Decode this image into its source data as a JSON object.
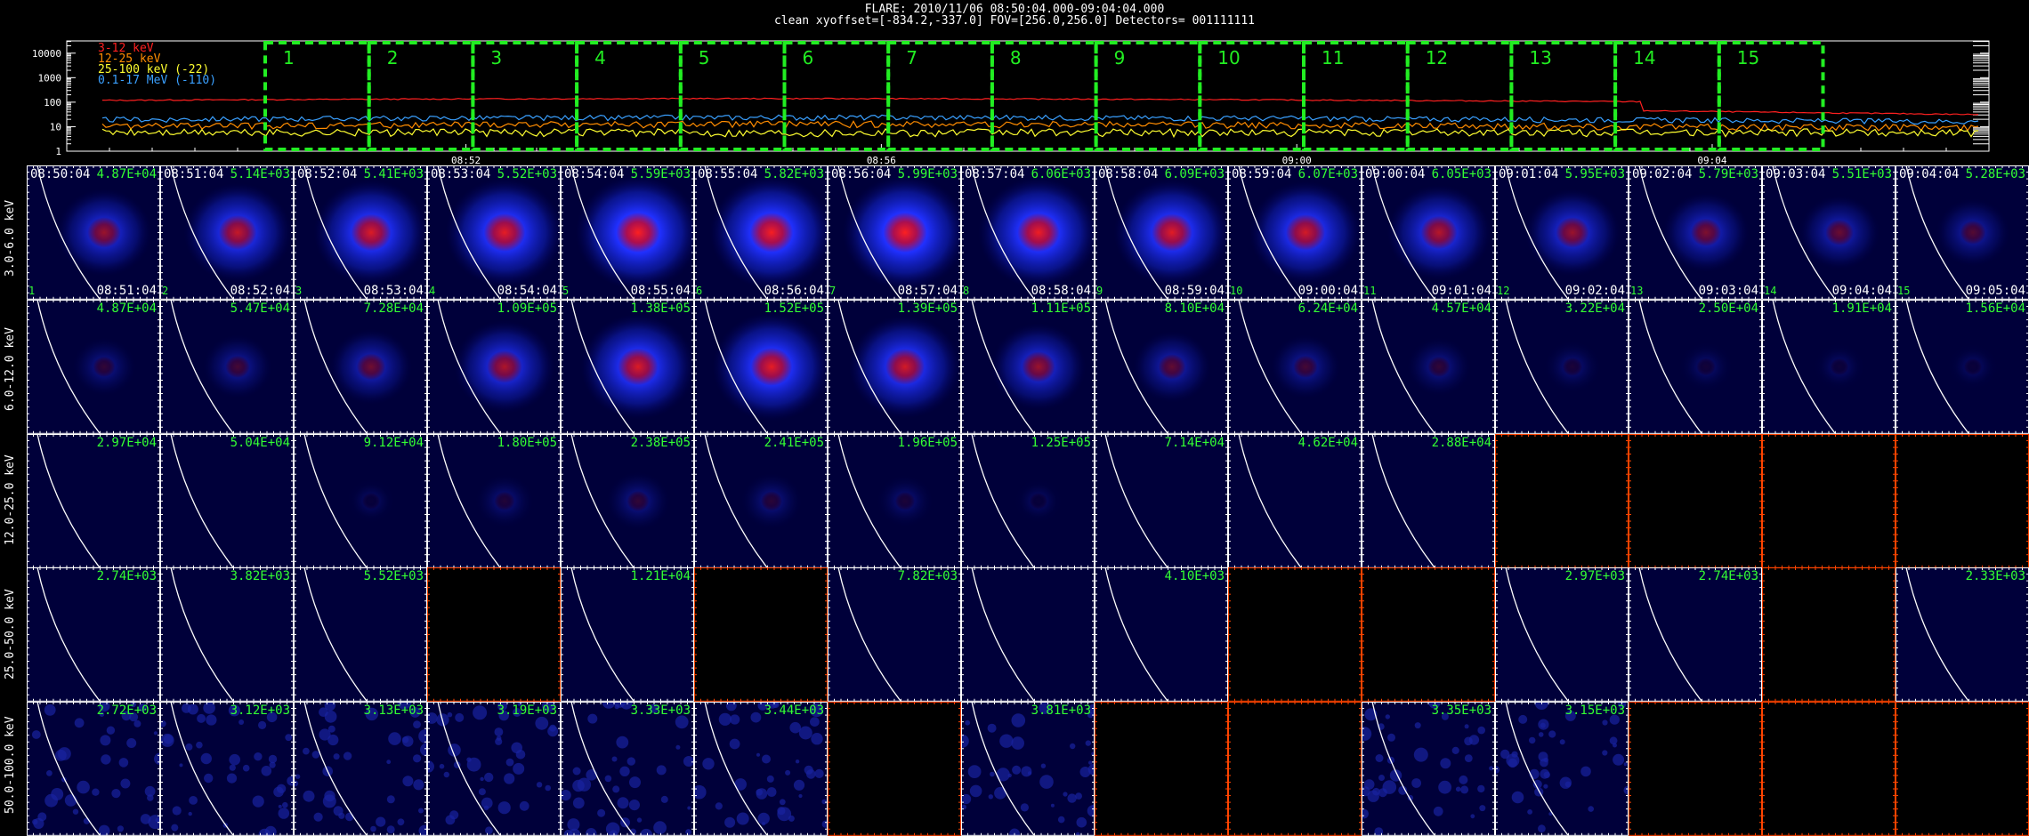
{
  "header": {
    "title": "FLARE: 2010/11/06 08:50:04.000-09:04:04.000",
    "subtitle": "clean    xyoffset=[-834.2,-337.0]   FOV=[256.0,256.0]   Detectors= 001111111"
  },
  "lightcurve": {
    "y_ticks": [
      "10000",
      "1000",
      "100",
      "10",
      "1"
    ],
    "x_ticks": [
      "08:52",
      "08:56",
      "09:00",
      "09:04"
    ],
    "legend": [
      {
        "label": "3-12 keV",
        "color": "#ff2020"
      },
      {
        "label": "12-25 keV",
        "color": "#ff8c00"
      },
      {
        "label": "25-100 keV (-22)",
        "color": "#ffff30"
      },
      {
        "label": "0.1-17 MeV (-110)",
        "color": "#3aa0ff"
      }
    ],
    "intervals": [
      "1",
      "2",
      "3",
      "4",
      "5",
      "6",
      "7",
      "8",
      "9",
      "10",
      "11",
      "12",
      "13",
      "14",
      "15"
    ],
    "interval_color": "#22ee22"
  },
  "grid": {
    "bands": [
      "3.0-6.0 keV",
      "6.0-12.0 keV",
      "12.0-25.0 keV",
      "25.0-50.0 keV",
      "50.0-100.0 keV"
    ],
    "start_times": [
      "08:50:04",
      "08:51:04",
      "08:52:04",
      "08:53:04",
      "08:54:04",
      "08:55:04",
      "08:56:04",
      "08:57:04",
      "08:58:04",
      "08:59:04",
      "09:00:04",
      "09:01:04",
      "09:02:04",
      "09:03:04",
      "09:04:04"
    ],
    "end_times": [
      "08:51:04",
      "08:52:04",
      "08:53:04",
      "08:54:04",
      "08:55:04",
      "08:56:04",
      "08:57:04",
      "08:58:04",
      "08:59:04",
      "09:00:04",
      "09:01:04",
      "09:02:04",
      "09:03:04",
      "09:04:04",
      "09:05:04"
    ],
    "indices": [
      "1",
      "2",
      "3",
      "4",
      "5",
      "6",
      "7",
      "8",
      "9",
      "10",
      "11",
      "12",
      "13",
      "14",
      "15"
    ],
    "peaks": [
      [
        "4.87E+04",
        "5.14E+03",
        "5.41E+03",
        "5.52E+03",
        "5.59E+03",
        "5.82E+03",
        "5.99E+03",
        "6.06E+03",
        "6.09E+03",
        "6.07E+03",
        "6.05E+03",
        "5.95E+03",
        "5.79E+03",
        "5.51E+03",
        "5.28E+03"
      ],
      [
        "4.87E+04",
        "5.47E+04",
        "7.28E+04",
        "1.09E+05",
        "1.38E+05",
        "1.52E+05",
        "1.39E+05",
        "1.11E+05",
        "8.10E+04",
        "6.24E+04",
        "4.57E+04",
        "3.22E+04",
        "2.50E+04",
        "1.91E+04",
        "1.56E+04"
      ],
      [
        "2.97E+04",
        "5.04E+04",
        "9.12E+04",
        "1.80E+05",
        "2.38E+05",
        "2.41E+05",
        "1.96E+05",
        "1.25E+05",
        "7.14E+04",
        "4.62E+04",
        "2.88E+04",
        "",
        "",
        "",
        ""
      ],
      [
        "2.74E+03",
        "3.82E+03",
        "5.52E+03",
        "",
        "1.21E+04",
        "",
        "7.82E+03",
        "",
        "4.10E+03",
        "",
        "",
        "2.97E+03",
        "2.74E+03",
        "",
        "2.33E+03"
      ],
      [
        "2.72E+03",
        "3.12E+03",
        "3.13E+03",
        "3.19E+03",
        "3.33E+03",
        "3.44E+03",
        "",
        "3.81E+03",
        "",
        "",
        "3.35E+03",
        "3.15E+03",
        "",
        "",
        ""
      ]
    ],
    "intensity": [
      [
        0.55,
        0.7,
        0.78,
        0.82,
        0.9,
        0.88,
        0.9,
        0.85,
        0.8,
        0.75,
        0.65,
        0.55,
        0.45,
        0.38,
        0.3
      ],
      [
        0.18,
        0.25,
        0.4,
        0.62,
        0.78,
        0.82,
        0.75,
        0.55,
        0.35,
        0.25,
        0.18,
        0.1,
        0.07,
        0.05,
        0.04
      ],
      [
        0,
        0,
        0.03,
        0.12,
        0.18,
        0.15,
        0.1,
        0.03,
        0,
        0,
        0,
        0,
        0,
        0,
        0
      ],
      [
        0,
        0,
        0,
        0,
        0,
        0,
        0,
        0,
        0,
        0,
        0,
        0,
        0,
        0,
        0
      ],
      [
        0,
        0,
        0,
        0,
        0,
        0,
        0,
        0,
        0,
        0,
        0,
        0,
        0,
        0,
        0
      ]
    ],
    "blank": [
      [
        false,
        false,
        false,
        false,
        false,
        false,
        false,
        false,
        false,
        false,
        false,
        false,
        false,
        false,
        false
      ],
      [
        false,
        false,
        false,
        false,
        false,
        false,
        false,
        false,
        false,
        false,
        false,
        false,
        false,
        false,
        false
      ],
      [
        false,
        false,
        false,
        false,
        false,
        false,
        false,
        false,
        false,
        false,
        false,
        true,
        true,
        true,
        true
      ],
      [
        false,
        false,
        false,
        true,
        false,
        true,
        false,
        false,
        false,
        true,
        true,
        false,
        false,
        true,
        false
      ],
      [
        false,
        false,
        false,
        false,
        false,
        false,
        true,
        false,
        true,
        true,
        false,
        false,
        true,
        true,
        true
      ]
    ],
    "colors": {
      "bg": "#00003a",
      "blank_bg": "#000000",
      "tick_normal": "#ffffff",
      "tick_blank": "#ff4400",
      "peak_text": "#33ff33",
      "limb": "#ffffff"
    }
  }
}
